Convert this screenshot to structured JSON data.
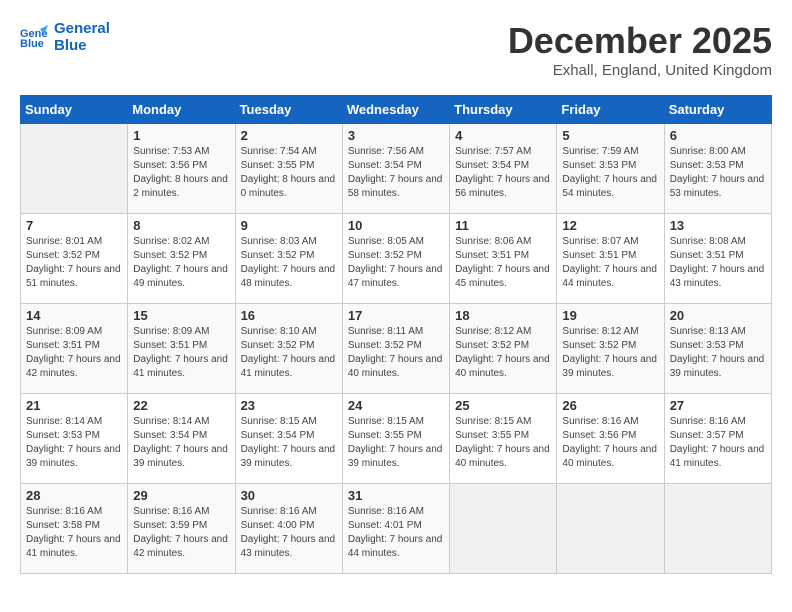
{
  "header": {
    "logo_line1": "General",
    "logo_line2": "Blue",
    "month_title": "December 2025",
    "subtitle": "Exhall, England, United Kingdom"
  },
  "weekdays": [
    "Sunday",
    "Monday",
    "Tuesday",
    "Wednesday",
    "Thursday",
    "Friday",
    "Saturday"
  ],
  "weeks": [
    [
      {
        "day": "",
        "info": ""
      },
      {
        "day": "1",
        "info": "Sunrise: 7:53 AM\nSunset: 3:56 PM\nDaylight: 8 hours\nand 2 minutes."
      },
      {
        "day": "2",
        "info": "Sunrise: 7:54 AM\nSunset: 3:55 PM\nDaylight: 8 hours\nand 0 minutes."
      },
      {
        "day": "3",
        "info": "Sunrise: 7:56 AM\nSunset: 3:54 PM\nDaylight: 7 hours\nand 58 minutes."
      },
      {
        "day": "4",
        "info": "Sunrise: 7:57 AM\nSunset: 3:54 PM\nDaylight: 7 hours\nand 56 minutes."
      },
      {
        "day": "5",
        "info": "Sunrise: 7:59 AM\nSunset: 3:53 PM\nDaylight: 7 hours\nand 54 minutes."
      },
      {
        "day": "6",
        "info": "Sunrise: 8:00 AM\nSunset: 3:53 PM\nDaylight: 7 hours\nand 53 minutes."
      }
    ],
    [
      {
        "day": "7",
        "info": "Sunrise: 8:01 AM\nSunset: 3:52 PM\nDaylight: 7 hours\nand 51 minutes."
      },
      {
        "day": "8",
        "info": "Sunrise: 8:02 AM\nSunset: 3:52 PM\nDaylight: 7 hours\nand 49 minutes."
      },
      {
        "day": "9",
        "info": "Sunrise: 8:03 AM\nSunset: 3:52 PM\nDaylight: 7 hours\nand 48 minutes."
      },
      {
        "day": "10",
        "info": "Sunrise: 8:05 AM\nSunset: 3:52 PM\nDaylight: 7 hours\nand 47 minutes."
      },
      {
        "day": "11",
        "info": "Sunrise: 8:06 AM\nSunset: 3:51 PM\nDaylight: 7 hours\nand 45 minutes."
      },
      {
        "day": "12",
        "info": "Sunrise: 8:07 AM\nSunset: 3:51 PM\nDaylight: 7 hours\nand 44 minutes."
      },
      {
        "day": "13",
        "info": "Sunrise: 8:08 AM\nSunset: 3:51 PM\nDaylight: 7 hours\nand 43 minutes."
      }
    ],
    [
      {
        "day": "14",
        "info": "Sunrise: 8:09 AM\nSunset: 3:51 PM\nDaylight: 7 hours\nand 42 minutes."
      },
      {
        "day": "15",
        "info": "Sunrise: 8:09 AM\nSunset: 3:51 PM\nDaylight: 7 hours\nand 41 minutes."
      },
      {
        "day": "16",
        "info": "Sunrise: 8:10 AM\nSunset: 3:52 PM\nDaylight: 7 hours\nand 41 minutes."
      },
      {
        "day": "17",
        "info": "Sunrise: 8:11 AM\nSunset: 3:52 PM\nDaylight: 7 hours\nand 40 minutes."
      },
      {
        "day": "18",
        "info": "Sunrise: 8:12 AM\nSunset: 3:52 PM\nDaylight: 7 hours\nand 40 minutes."
      },
      {
        "day": "19",
        "info": "Sunrise: 8:12 AM\nSunset: 3:52 PM\nDaylight: 7 hours\nand 39 minutes."
      },
      {
        "day": "20",
        "info": "Sunrise: 8:13 AM\nSunset: 3:53 PM\nDaylight: 7 hours\nand 39 minutes."
      }
    ],
    [
      {
        "day": "21",
        "info": "Sunrise: 8:14 AM\nSunset: 3:53 PM\nDaylight: 7 hours\nand 39 minutes."
      },
      {
        "day": "22",
        "info": "Sunrise: 8:14 AM\nSunset: 3:54 PM\nDaylight: 7 hours\nand 39 minutes."
      },
      {
        "day": "23",
        "info": "Sunrise: 8:15 AM\nSunset: 3:54 PM\nDaylight: 7 hours\nand 39 minutes."
      },
      {
        "day": "24",
        "info": "Sunrise: 8:15 AM\nSunset: 3:55 PM\nDaylight: 7 hours\nand 39 minutes."
      },
      {
        "day": "25",
        "info": "Sunrise: 8:15 AM\nSunset: 3:55 PM\nDaylight: 7 hours\nand 40 minutes."
      },
      {
        "day": "26",
        "info": "Sunrise: 8:16 AM\nSunset: 3:56 PM\nDaylight: 7 hours\nand 40 minutes."
      },
      {
        "day": "27",
        "info": "Sunrise: 8:16 AM\nSunset: 3:57 PM\nDaylight: 7 hours\nand 41 minutes."
      }
    ],
    [
      {
        "day": "28",
        "info": "Sunrise: 8:16 AM\nSunset: 3:58 PM\nDaylight: 7 hours\nand 41 minutes."
      },
      {
        "day": "29",
        "info": "Sunrise: 8:16 AM\nSunset: 3:59 PM\nDaylight: 7 hours\nand 42 minutes."
      },
      {
        "day": "30",
        "info": "Sunrise: 8:16 AM\nSunset: 4:00 PM\nDaylight: 7 hours\nand 43 minutes."
      },
      {
        "day": "31",
        "info": "Sunrise: 8:16 AM\nSunset: 4:01 PM\nDaylight: 7 hours\nand 44 minutes."
      },
      {
        "day": "",
        "info": ""
      },
      {
        "day": "",
        "info": ""
      },
      {
        "day": "",
        "info": ""
      }
    ]
  ]
}
